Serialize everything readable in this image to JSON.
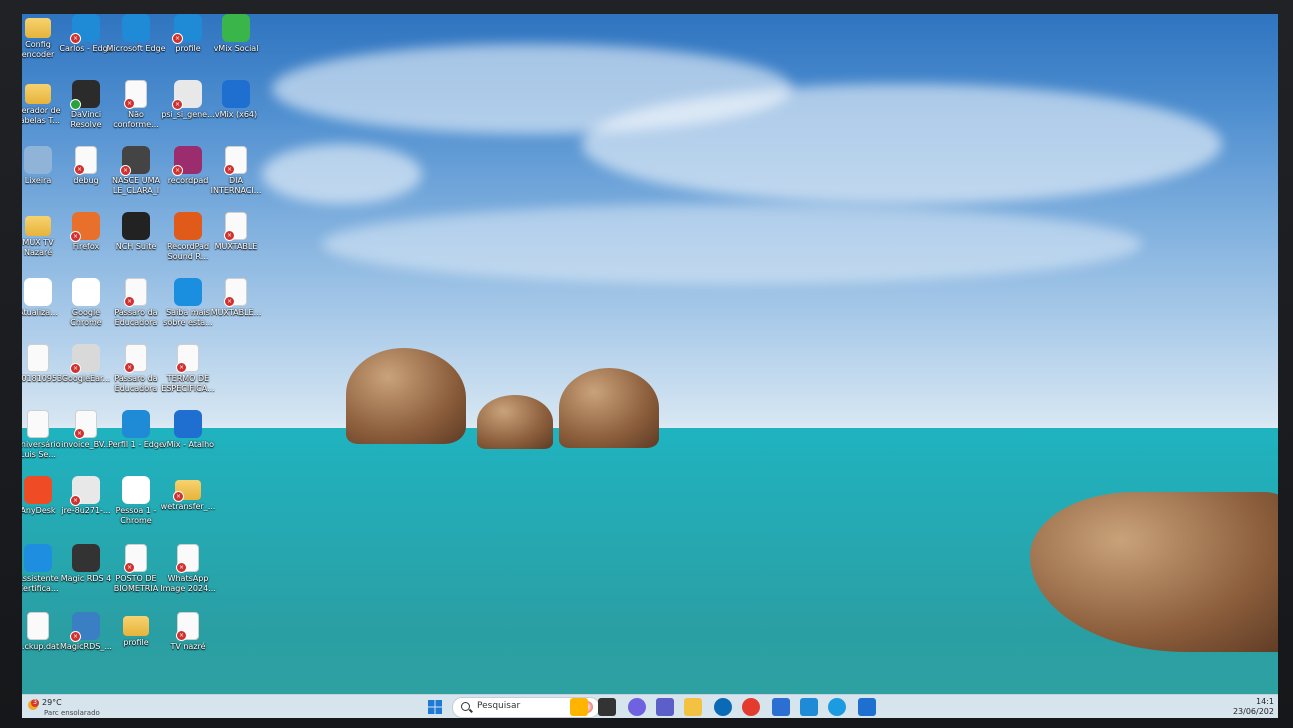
{
  "desktop": {
    "icons": [
      {
        "label": "Config encoder",
        "icon": "folder-icon",
        "kind": "folder",
        "badge": "none",
        "col": 0,
        "row": 0
      },
      {
        "label": "Carlos - Edge",
        "icon": "edge-icon",
        "kind": "app",
        "color": "#1f8ad6",
        "badge": "error",
        "col": 1,
        "row": 0
      },
      {
        "label": "Microsoft Edge",
        "icon": "edge-icon",
        "kind": "app",
        "color": "#1f8ad6",
        "badge": "none",
        "col": 2,
        "row": 0
      },
      {
        "label": "profile",
        "icon": "edge-icon",
        "kind": "app",
        "color": "#1f8ad6",
        "badge": "error",
        "col": 3,
        "row": 0
      },
      {
        "label": "vMix Social",
        "icon": "vmix-social-icon",
        "kind": "app",
        "color": "#39b54a",
        "badge": "none",
        "col": 4,
        "row": 0
      },
      {
        "label": "Gerador de Tabelas T...",
        "icon": "folder-icon",
        "kind": "folder",
        "badge": "none",
        "col": 0,
        "row": 1
      },
      {
        "label": "DaVinci Resolve",
        "icon": "davinci-resolve-icon",
        "kind": "app",
        "color": "#2b2b2b",
        "badge": "ok",
        "col": 1,
        "row": 1
      },
      {
        "label": "Não conforme...",
        "icon": "document-icon",
        "kind": "doc",
        "badge": "error",
        "col": 2,
        "row": 1
      },
      {
        "label": "psi_si_gene...",
        "icon": "java-icon",
        "kind": "app",
        "color": "#e8e8e8",
        "badge": "error",
        "col": 3,
        "row": 1
      },
      {
        "label": "vMix (x64)",
        "icon": "vmix-icon",
        "kind": "app",
        "color": "#1f6fd0",
        "badge": "none",
        "col": 4,
        "row": 1
      },
      {
        "label": "Lixeira",
        "icon": "recycle-bin-icon",
        "kind": "app",
        "color": "#8fb4d8",
        "badge": "none",
        "col": 0,
        "row": 2
      },
      {
        "label": "debug",
        "icon": "document-icon",
        "kind": "doc",
        "badge": "error",
        "col": 1,
        "row": 2
      },
      {
        "label": "NASCE UMA LE_CLARA_I",
        "icon": "video-file-icon",
        "kind": "app",
        "color": "#444",
        "badge": "error",
        "col": 2,
        "row": 2
      },
      {
        "label": "recordpad",
        "icon": "winrar-icon",
        "kind": "app",
        "color": "#9b2d6e",
        "badge": "error",
        "col": 3,
        "row": 2
      },
      {
        "label": "DIA INTERNACI...",
        "icon": "media-file-icon",
        "kind": "doc",
        "badge": "error",
        "col": 4,
        "row": 2
      },
      {
        "label": "MUX TV Nazaré",
        "icon": "folder-icon",
        "kind": "folder",
        "badge": "none",
        "col": 0,
        "row": 3
      },
      {
        "label": "Firefox",
        "icon": "firefox-icon",
        "kind": "app",
        "color": "#e8702a",
        "badge": "error",
        "col": 1,
        "row": 3
      },
      {
        "label": "NCH Suite",
        "icon": "nch-icon",
        "kind": "app",
        "color": "#222",
        "badge": "none",
        "col": 2,
        "row": 3
      },
      {
        "label": "RecordPad Sound R...",
        "icon": "recordpad-icon",
        "kind": "app",
        "color": "#e05b1a",
        "badge": "none",
        "col": 3,
        "row": 3
      },
      {
        "label": "MUXTABLE",
        "icon": "document-icon",
        "kind": "doc",
        "badge": "error",
        "col": 4,
        "row": 3
      },
      {
        "label": "Atualiza...",
        "icon": "chrome-icon",
        "kind": "app",
        "color": "#fff",
        "badge": "none",
        "col": 0,
        "row": 4
      },
      {
        "label": "Google Chrome",
        "icon": "chrome-icon",
        "kind": "app",
        "color": "#fff",
        "badge": "none",
        "col": 1,
        "row": 4
      },
      {
        "label": "Pássaro da Educadora",
        "icon": "image-file-icon",
        "kind": "doc",
        "badge": "error",
        "col": 2,
        "row": 4
      },
      {
        "label": "Saiba mais sobre esta...",
        "icon": "info-icon",
        "kind": "app",
        "color": "#1a8fe0",
        "badge": "none",
        "col": 3,
        "row": 4
      },
      {
        "label": "MUXTABLE...",
        "icon": "document-icon",
        "kind": "doc",
        "badge": "error",
        "col": 4,
        "row": 4
      },
      {
        "label": "...01810953",
        "icon": "image-file-icon",
        "kind": "doc",
        "badge": "none",
        "col": 0,
        "row": 5
      },
      {
        "label": "GoogleEar...",
        "icon": "google-earth-icon",
        "kind": "app",
        "color": "#d9d9d9",
        "badge": "error",
        "col": 1,
        "row": 5
      },
      {
        "label": "Pássaro da Educadora",
        "icon": "image-file-icon",
        "kind": "doc",
        "badge": "error",
        "col": 2,
        "row": 5
      },
      {
        "label": "TERMO DE ESPECIFICA...",
        "icon": "word-file-icon",
        "kind": "doc",
        "badge": "error",
        "col": 3,
        "row": 5
      },
      {
        "label": "Aniversário Luis Se...",
        "icon": "media-file-icon",
        "kind": "doc",
        "badge": "none",
        "col": 0,
        "row": 6
      },
      {
        "label": "invoice_BV...",
        "icon": "pdf-icon",
        "kind": "doc",
        "badge": "error",
        "col": 1,
        "row": 6
      },
      {
        "label": "Perfil 1 - Edge",
        "icon": "edge-icon",
        "kind": "app",
        "color": "#1f8ad6",
        "badge": "none",
        "col": 2,
        "row": 6
      },
      {
        "label": "vMix - Atalho",
        "icon": "vmix-icon",
        "kind": "app",
        "color": "#1f6fd0",
        "badge": "none",
        "col": 3,
        "row": 6
      },
      {
        "label": "AnyDesk",
        "icon": "anydesk-icon",
        "kind": "app",
        "color": "#ef4b24",
        "badge": "none",
        "col": 0,
        "row": 7
      },
      {
        "label": "jre-8u271-...",
        "icon": "java-icon",
        "kind": "app",
        "color": "#e8e8e8",
        "badge": "error",
        "col": 1,
        "row": 7
      },
      {
        "label": "Pessoa 1 - Chrome",
        "icon": "chrome-icon",
        "kind": "app",
        "color": "#fff",
        "badge": "none",
        "col": 2,
        "row": 7
      },
      {
        "label": "wetransfer_...",
        "icon": "folder-icon",
        "kind": "folder",
        "badge": "error",
        "col": 3,
        "row": 7
      },
      {
        "label": "Assistente Certifica...",
        "icon": "lock-icon",
        "kind": "app",
        "color": "#1e8fe0",
        "badge": "none",
        "col": 0,
        "row": 8
      },
      {
        "label": "Magic RDS 4",
        "icon": "magic-rds-icon",
        "kind": "app",
        "color": "#333",
        "badge": "none",
        "col": 1,
        "row": 8
      },
      {
        "label": "POSTO DE BIOMETRIA",
        "icon": "media-file-icon",
        "kind": "doc",
        "badge": "error",
        "col": 2,
        "row": 8
      },
      {
        "label": "WhatsApp Image 2024...",
        "icon": "image-file-icon",
        "kind": "doc",
        "badge": "error",
        "col": 3,
        "row": 8
      },
      {
        "label": "...ckup.dat",
        "icon": "document-icon",
        "kind": "doc",
        "badge": "none",
        "col": 0,
        "row": 9
      },
      {
        "label": "MagicRDS_...",
        "icon": "magic-rds-setup-icon",
        "kind": "app",
        "color": "#3a7fc4",
        "badge": "error",
        "col": 1,
        "row": 9
      },
      {
        "label": "profile",
        "icon": "folder-icon",
        "kind": "folder",
        "badge": "none",
        "col": 2,
        "row": 9
      },
      {
        "label": "TV nazré",
        "icon": "media-file-icon",
        "kind": "doc",
        "badge": "error",
        "col": 3,
        "row": 9
      }
    ]
  },
  "taskbar": {
    "weather": {
      "notification_count": "3",
      "temperature": "29°C",
      "condition": "Parc ensolarado"
    },
    "search_placeholder": "Pesquisar",
    "pinned": [
      {
        "icon": "start-windows-icon",
        "color": "#1f7ad6"
      },
      {
        "icon": "search-highlight-icon",
        "color": "#ffb400"
      },
      {
        "icon": "task-view-icon",
        "color": "#333"
      },
      {
        "icon": "copilot-icon",
        "color": "#6f61e0"
      },
      {
        "icon": "teams-icon",
        "color": "#5b5fc7"
      },
      {
        "icon": "file-explorer-icon",
        "color": "#f3c242"
      },
      {
        "icon": "dell-icon",
        "color": "#0b6ab6"
      },
      {
        "icon": "chrome-icon",
        "color": "#e33b2e"
      },
      {
        "icon": "store-icon",
        "color": "#2b6fd2"
      },
      {
        "icon": "edge-icon",
        "color": "#1f8ad6"
      },
      {
        "icon": "network-app-icon",
        "color": "#1c9ce0"
      },
      {
        "icon": "vmix-icon",
        "color": "#1f6fd0"
      }
    ],
    "clock": {
      "time": "14:1",
      "date": "23/06/202"
    }
  }
}
